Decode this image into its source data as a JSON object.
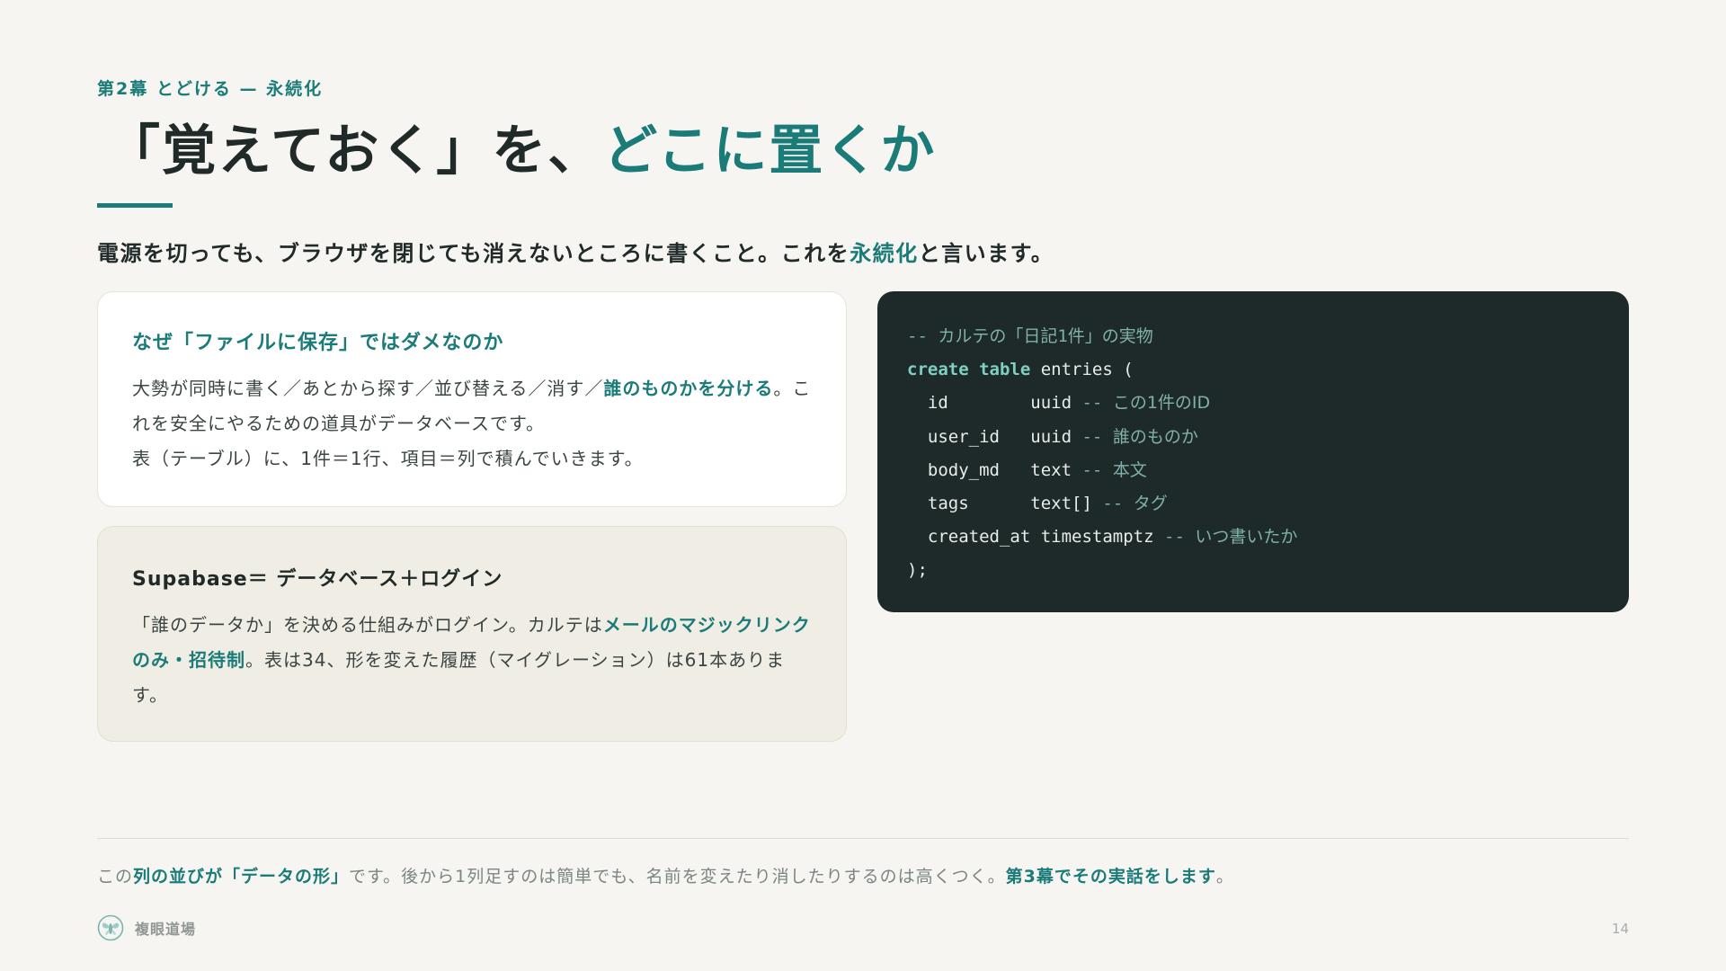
{
  "header": {
    "kicker": "第2幕 とどける — 永続化",
    "title_main": "「覚えておく」を、",
    "title_accent": "どこに置くか"
  },
  "lead": {
    "before": "電源を切っても、ブラウザを閉じても消えないところに書くこと。これを",
    "highlight": "永続化",
    "after": "と言います。"
  },
  "card_why": {
    "title": "なぜ「ファイルに保存」ではダメなのか",
    "line1_before": "大勢が同時に書く／あとから探す／並び替える／消す／",
    "line1_highlight": "誰のものかを分ける",
    "line1_after": "。これを安全にやるための道具がデータベースです。",
    "line2": "表（テーブル）に、1件＝1行、項目＝列で積んでいきます。"
  },
  "card_supabase": {
    "title": "Supabase＝ データベース＋ログイン",
    "before": "「誰のデータか」を決める仕組みがログイン。カルテは",
    "highlight": "メールのマジックリンクのみ・招待制",
    "after": "。表は34、形を変えた履歴（マイグレーション）は61本あります。"
  },
  "code": {
    "comment_title": "-- カルテの「日記1件」の実物",
    "create": "create table",
    "table_name": "entries (",
    "columns": [
      {
        "name": "id        ",
        "type": "uuid",
        "dash": " -- ",
        "note": "この1件のID"
      },
      {
        "name": "user_id   ",
        "type": "uuid",
        "dash": " -- ",
        "note": "誰のものか"
      },
      {
        "name": "body_md   ",
        "type": "text",
        "dash": " -- ",
        "note": "本文"
      },
      {
        "name": "tags      ",
        "type": "text[]",
        "dash": " -- ",
        "note": "タグ"
      },
      {
        "name": "created_at ",
        "type": "timestamptz",
        "dash": " -- ",
        "note": "いつ書いたか"
      }
    ],
    "close": ");"
  },
  "footnote": {
    "pre": "この",
    "hl1": "列の並びが「データの形」",
    "mid": "です。後から1列足すのは簡単でも、名前を変えたり消したりするのは高くつく。",
    "hl2": "第3幕でその実話をします",
    "end": "。"
  },
  "brand": {
    "name": "複眼道場",
    "logo_icon": "compound-eye-insect-icon"
  },
  "page_number": "14",
  "colors": {
    "background": "#f6f5f1",
    "accent": "#1a7b78",
    "text": "#1f2a29",
    "code_bg": "#1e2a29"
  }
}
